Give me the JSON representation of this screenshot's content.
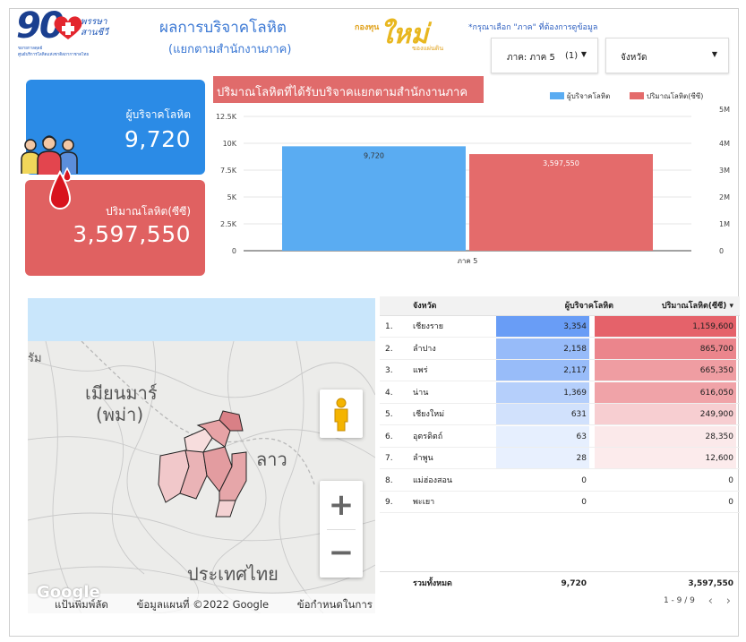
{
  "header": {
    "logo_left": {
      "number": "90",
      "line1": "พรรษา",
      "line2": "สานชีวี",
      "line3": "ขยายกาลดุลย์",
      "line4": "ศูนย์บริการโลหิตแห่งชาติสภากาชาดไทย"
    },
    "title": "ผลการบริจาคโลหิต",
    "subtitle": "(แยกตามสำนักงานภาค)",
    "logo_mid": {
      "a": "กองทุน",
      "b": "ใหม่",
      "c": "ของแผ่นดิน"
    },
    "hint": "*กรุณาเลือก \"ภาค\" ที่ต้องการดูข้อมูล",
    "filter_region": {
      "label": "ภาค: ภาค 5",
      "count": "(1)"
    },
    "filter_province": {
      "label": "จังหวัด"
    }
  },
  "cards": {
    "donors": {
      "label": "ผู้บริจาคโลหิต",
      "value": "9,720",
      "color": "#2b8be6"
    },
    "volume": {
      "label": "ปริมาณโลหิต(ซีซี)",
      "value": "3,597,550",
      "color": "#e06161"
    }
  },
  "chart": {
    "title": "ปริมาณโลหิตที่ได้รับบริจาคแยกตามสำนักงานภาค",
    "legend": [
      {
        "name": "ผู้บริจาคโลหิต",
        "color": "#5aacf2"
      },
      {
        "name": "ปริมาณโลหิต(ซีซี)",
        "color": "#e46b6b"
      }
    ]
  },
  "chart_data": {
    "type": "bar",
    "categories": [
      "ภาค 5"
    ],
    "series": [
      {
        "name": "ผู้บริจาคโลหิต",
        "values": [
          9720
        ],
        "axis": "left",
        "label": "9,720"
      },
      {
        "name": "ปริมาณโลหิต(ซีซี)",
        "values": [
          3597550
        ],
        "axis": "right",
        "label": "3,597,550"
      }
    ],
    "title": "ปริมาณโลหิตที่ได้รับบริจาคแยกตามสำนักงานภาค",
    "ylim_left": [
      0,
      12500
    ],
    "ylim_right": [
      0,
      5000000
    ],
    "left_ticks": [
      "0",
      "2.5K",
      "5K",
      "7.5K",
      "10K",
      "12.5K"
    ],
    "right_ticks": [
      "0",
      "1M",
      "2M",
      "3M",
      "4M",
      "5M"
    ],
    "grid": true,
    "legend_position": "top-right"
  },
  "map": {
    "labels": {
      "rum": "รัม",
      "myanmar1": "เมียนมาร์",
      "myanmar2": "(พม่า)",
      "laos": "ลาว",
      "thailand": "ประเทศไทย"
    },
    "google": "Google",
    "attribution": [
      "แป้นพิมพ์ลัด",
      "ข้อมูลแผนที่ ©2022 Google",
      "ข้อกำหนดในการใช้งาน"
    ],
    "zoom_in": "+",
    "zoom_out": "−"
  },
  "table": {
    "headers": {
      "province": "จังหวัด",
      "donors": "ผู้บริจาคโลหิต",
      "volume": "ปริมาณโลหิต(ซีซี)",
      "sort": "▾"
    },
    "rows": [
      {
        "idx": "1.",
        "province": "เชียงราย",
        "donors": "3,354",
        "volume": "1,159,600",
        "donors_n": 3354,
        "volume_n": 1159600
      },
      {
        "idx": "2.",
        "province": "ลำปาง",
        "donors": "2,158",
        "volume": "865,700",
        "donors_n": 2158,
        "volume_n": 865700
      },
      {
        "idx": "3.",
        "province": "แพร่",
        "donors": "2,117",
        "volume": "665,350",
        "donors_n": 2117,
        "volume_n": 665350
      },
      {
        "idx": "4.",
        "province": "น่าน",
        "donors": "1,369",
        "volume": "616,050",
        "donors_n": 1369,
        "volume_n": 616050
      },
      {
        "idx": "5.",
        "province": "เชียงใหม่",
        "donors": "631",
        "volume": "249,900",
        "donors_n": 631,
        "volume_n": 249900
      },
      {
        "idx": "6.",
        "province": "อุตรดิตถ์",
        "donors": "63",
        "volume": "28,350",
        "donors_n": 63,
        "volume_n": 28350
      },
      {
        "idx": "7.",
        "province": "ลำพูน",
        "donors": "28",
        "volume": "12,600",
        "donors_n": 28,
        "volume_n": 12600
      },
      {
        "idx": "8.",
        "province": "แม่ฮ่องสอน",
        "donors": "0",
        "volume": "0",
        "donors_n": 0,
        "volume_n": 0
      },
      {
        "idx": "9.",
        "province": "พะเยา",
        "donors": "0",
        "volume": "0",
        "donors_n": 0,
        "volume_n": 0
      }
    ],
    "total": {
      "label": "รวมทั้งหมด",
      "donors": "9,720",
      "volume": "3,597,550"
    },
    "pager": "1 - 9 / 9",
    "prev": "‹",
    "next": "›"
  }
}
